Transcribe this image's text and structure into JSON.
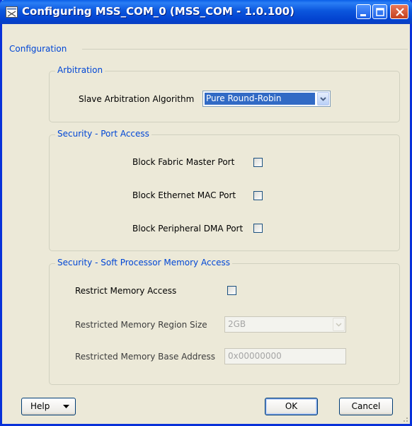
{
  "window": {
    "title": "Configuring MSS_COM_0 (MSS_COM - 1.0.100)"
  },
  "configuration": {
    "legend": "Configuration",
    "arbitration": {
      "legend": "Arbitration",
      "algorithm_label": "Slave Arbitration Algorithm",
      "algorithm_value": "Pure Round-Robin"
    },
    "port_access": {
      "legend": "Security - Port Access",
      "items": [
        {
          "label": "Block Fabric Master Port",
          "checked": false
        },
        {
          "label": "Block Ethernet MAC Port",
          "checked": false
        },
        {
          "label": "Block Peripheral DMA Port",
          "checked": false
        }
      ]
    },
    "memory_access": {
      "legend": "Security - Soft Processor Memory Access",
      "restrict_label": "Restrict Memory Access",
      "restrict_checked": false,
      "region_size_label": "Restricted Memory Region Size",
      "region_size_value": "2GB",
      "base_address_label": "Restricted Memory Base Address",
      "base_address_value": "0x00000000"
    }
  },
  "buttons": {
    "help": "Help",
    "ok": "OK",
    "cancel": "Cancel"
  },
  "colors": {
    "titlebar": "#0a5fe8",
    "legend_text": "#0046d5",
    "selection": "#316ac5",
    "window_bg": "#ece9d8"
  },
  "icons": [
    "app-icon",
    "minimize-icon",
    "maximize-icon",
    "close-icon",
    "chevron-down-icon",
    "caret-down-icon",
    "resize-grip-icon"
  ]
}
